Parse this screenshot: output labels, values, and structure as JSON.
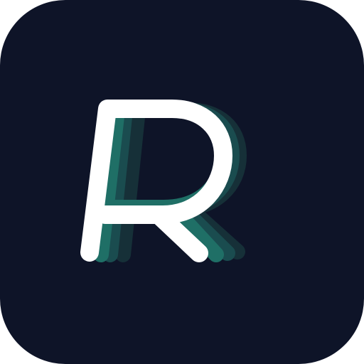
{
  "app_icon": {
    "icon_name": "r-letter-logo-icon",
    "colors": {
      "background": "#0E1428",
      "primary_glyph": "#FFFFFF",
      "echo_front": "#1F6F66",
      "echo_middle": "#1A4C4F",
      "echo_back": "#163038"
    }
  }
}
